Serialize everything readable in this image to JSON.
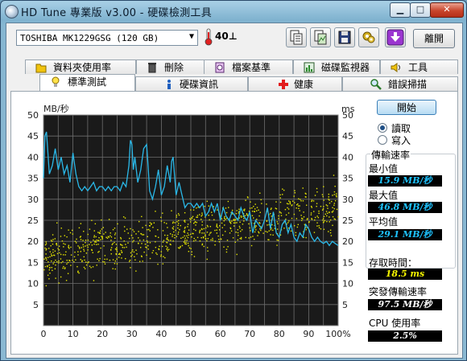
{
  "window": {
    "title": "HD Tune 專業版 v3.00 - 硬碟檢測工具",
    "controls": {
      "minimize": "▁",
      "maximize": "□",
      "close": "✕"
    }
  },
  "toolbar": {
    "drive": "TOSHIBA MK1229GSG (120 GB)",
    "temperature": "40⊥",
    "exit_label": "離開",
    "icons": [
      "copy-text-icon",
      "copy-screenshot-icon",
      "save-icon",
      "options-icon",
      "download-icon"
    ]
  },
  "tabs_row1": [
    {
      "label": "資料夾使用率",
      "icon": "folder-icon"
    },
    {
      "label": "刪除",
      "icon": "trash-icon"
    },
    {
      "label": "檔案基準",
      "icon": "file-benchmark-icon"
    },
    {
      "label": "磁碟監視器",
      "icon": "disk-monitor-icon"
    },
    {
      "label": "工具",
      "icon": "speaker-icon"
    }
  ],
  "tabs_row2": [
    {
      "label": "標準測試",
      "icon": "bulb-icon",
      "active": true
    },
    {
      "label": "硬碟資訊",
      "icon": "info-icon"
    },
    {
      "label": "健康",
      "icon": "health-cross-icon"
    },
    {
      "label": "錯誤掃描",
      "icon": "magnifier-icon"
    }
  ],
  "controls": {
    "start_label": "開始",
    "read_label": "讀取",
    "write_label": "寫入",
    "mode_selected": "read"
  },
  "stats": {
    "transfer_title": "傳輸速率",
    "min_label": "最小值",
    "min_value": "15.9 MB/秒",
    "max_label": "最大值",
    "max_value": "46.8 MB/秒",
    "avg_label": "平均值",
    "avg_value": "29.1 MB/秒",
    "access_label": "存取時間：",
    "access_value": "18.5 ms",
    "burst_label": "突發傳輸速率",
    "burst_value": "97.5 MB/秒",
    "cpu_label": "CPU 使用率",
    "cpu_value": "2.5%"
  },
  "chart_data": {
    "type": "line",
    "left_unit": "MB/秒",
    "right_unit": "ms",
    "y_ticks_left": [
      5,
      10,
      15,
      20,
      25,
      30,
      35,
      40,
      45,
      50
    ],
    "y_ticks_right": [
      5,
      10,
      15,
      20,
      25,
      30,
      35,
      40,
      45,
      50
    ],
    "x_ticks": [
      "0",
      "10",
      "20",
      "30",
      "40",
      "50",
      "60",
      "70",
      "80",
      "90",
      "100%"
    ],
    "ylim": [
      0,
      50
    ],
    "xlim": [
      0,
      100
    ],
    "grid": true,
    "colors": {
      "background": "#1a1a1a",
      "grid": "#6e6e6e",
      "transfer": "#2ab8e8",
      "access": "#e6e600"
    },
    "series": [
      {
        "kind": "transfer_rate",
        "x": [
          0,
          0.5,
          1,
          1.5,
          2,
          3,
          4,
          5,
          6,
          7,
          8,
          9,
          10,
          11,
          12,
          13,
          14,
          15,
          16,
          17,
          18,
          19,
          20,
          21,
          22,
          23,
          24,
          25,
          26,
          27,
          28,
          29,
          29.5,
          30,
          30.5,
          31,
          32,
          33,
          34,
          35,
          35.5,
          36,
          37,
          38,
          39,
          40,
          41,
          42,
          43,
          43.5,
          44,
          45,
          46,
          47,
          48,
          49,
          50,
          51,
          52,
          53,
          54,
          55,
          56,
          57,
          58,
          59,
          60,
          61,
          62,
          63,
          64,
          65,
          66,
          67,
          68,
          69,
          70,
          71,
          72,
          73,
          74,
          75,
          76,
          77,
          78,
          79,
          80,
          81,
          82,
          83,
          84,
          85,
          86,
          87,
          88,
          89,
          90,
          91,
          92,
          93,
          94,
          95,
          96,
          97,
          98,
          99,
          100
        ],
        "y": [
          35,
          45,
          46,
          41,
          36,
          38,
          42,
          37,
          40,
          36,
          38,
          34,
          41,
          36,
          33,
          32,
          33,
          32,
          33,
          34,
          32,
          33,
          33,
          32,
          33,
          32,
          33,
          33,
          32,
          34,
          33,
          38,
          44,
          43,
          37,
          40,
          34,
          37,
          42,
          43,
          38,
          32,
          30,
          33,
          37,
          31,
          33,
          38,
          34,
          39,
          40,
          31,
          34,
          31,
          28,
          29,
          29,
          28,
          29,
          28,
          29,
          26,
          27,
          29,
          27,
          29,
          25,
          28,
          26,
          25,
          27,
          26,
          25,
          28,
          26,
          25,
          27,
          22,
          25,
          24,
          23,
          25,
          28,
          23,
          27,
          22,
          21,
          24,
          25,
          22,
          24,
          21,
          20,
          22,
          21,
          24,
          23,
          21,
          20,
          21,
          20,
          19.5,
          20,
          19,
          20,
          19.5,
          19
        ]
      },
      {
        "kind": "access_time",
        "points": "scatter cloud from ~10–25 ms at left rising to ~15–30 ms at right"
      }
    ]
  }
}
